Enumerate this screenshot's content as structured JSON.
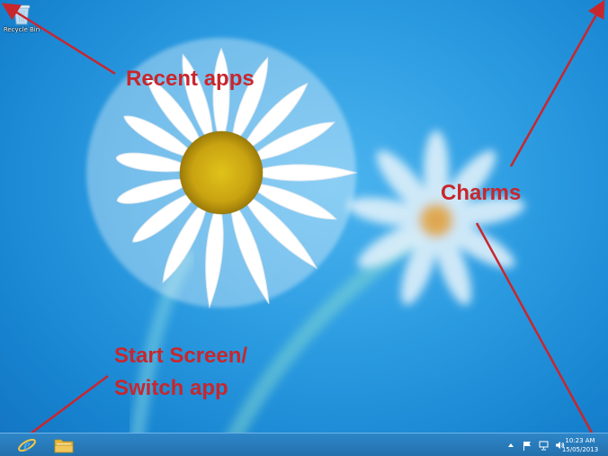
{
  "desktop": {
    "icons": [
      {
        "label": "Recycle Bin",
        "icon": "recycle-bin-icon"
      }
    ]
  },
  "annotations": {
    "recent_apps": "Recent apps",
    "charms": "Charms",
    "start_screen_line1": "Start Screen/",
    "start_screen_line2": "Switch app"
  },
  "taskbar": {
    "pinned": [
      {
        "name": "Internet Explorer",
        "icon": "internet-explorer-icon"
      },
      {
        "name": "File Explorer",
        "icon": "folder-icon"
      }
    ],
    "tray": {
      "icons": [
        "chevron-up-icon",
        "flag-icon",
        "network-icon",
        "speaker-icon"
      ]
    },
    "clock": {
      "time": "10:23 AM",
      "date": "15/05/2013"
    }
  },
  "colors": {
    "annotation": "#c8262d",
    "taskbar": "#2a7dbd",
    "wallpaper": "#2a9ae0"
  }
}
